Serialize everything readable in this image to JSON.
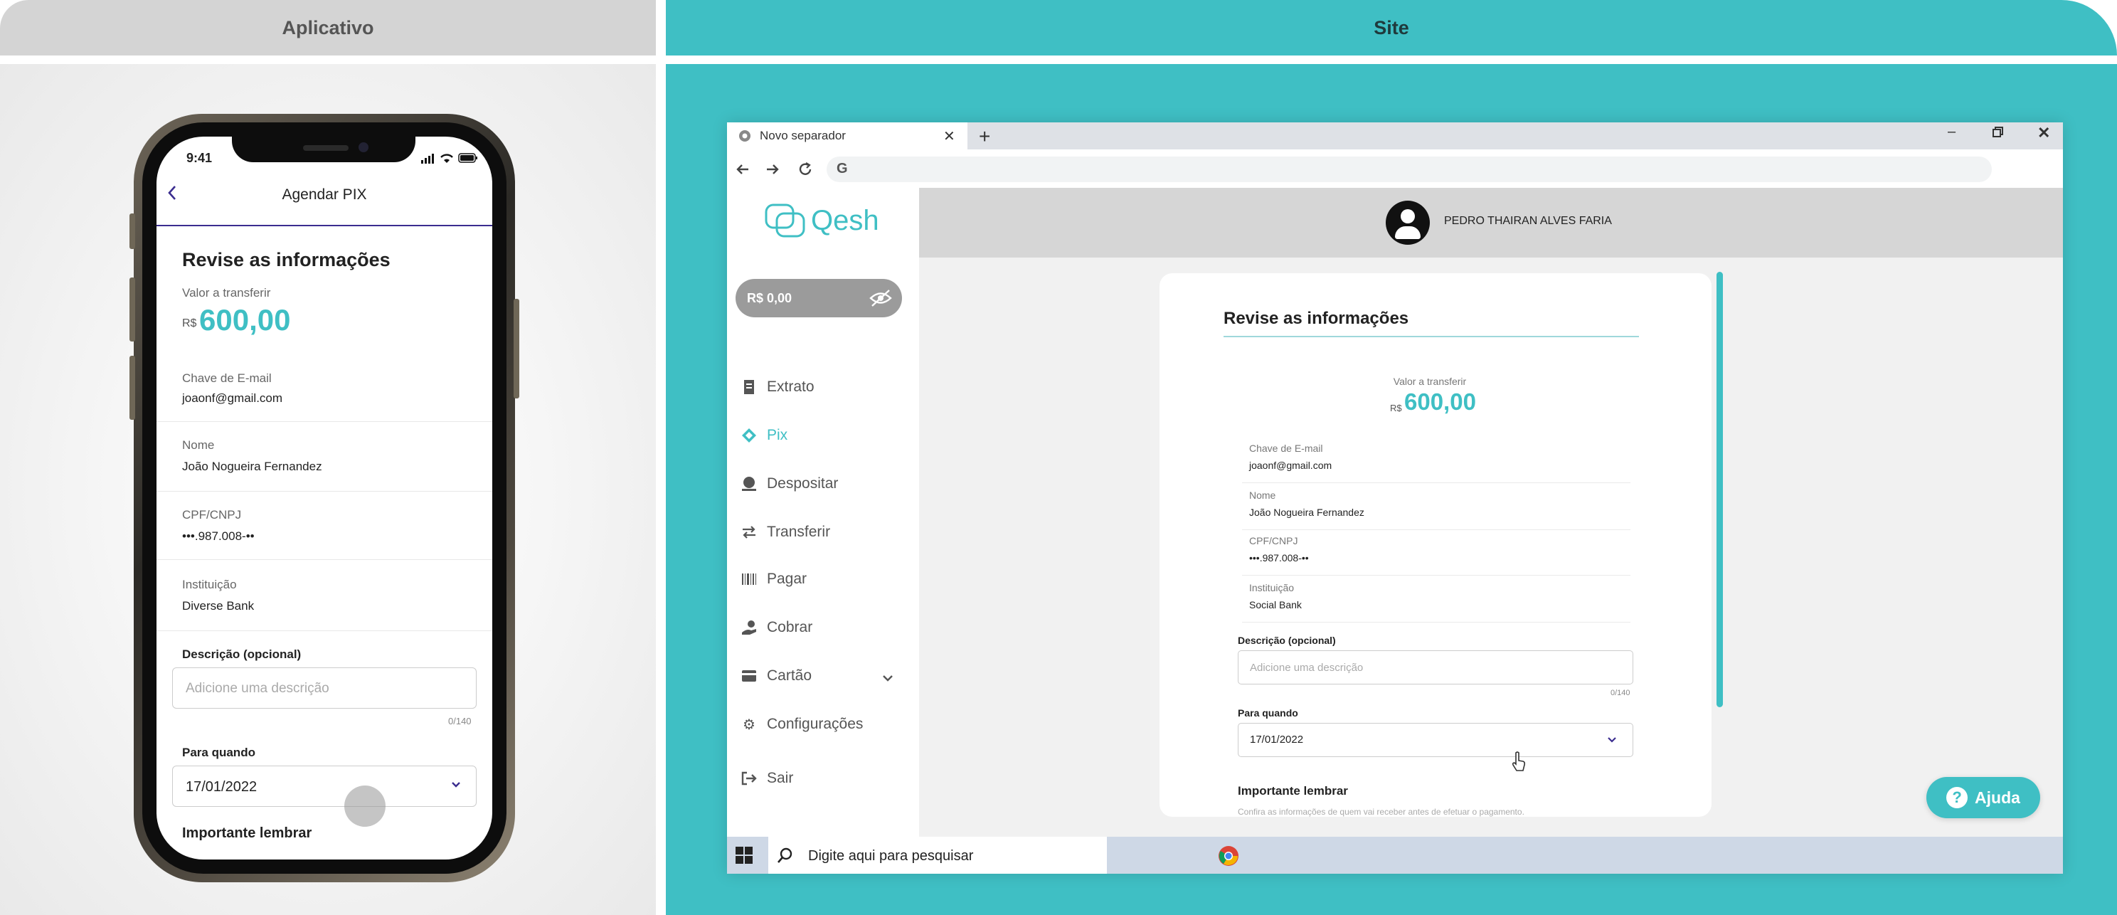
{
  "panels": {
    "left_title": "Aplicativo",
    "right_title": "Site"
  },
  "colors": {
    "accent": "#3fbfc4",
    "purple": "#3b2d8f"
  },
  "phone": {
    "time": "9:41",
    "nav_title": "Agendar PIX",
    "heading": "Revise as informações",
    "amount_label": "Valor a transferir",
    "currency": "R$",
    "amount": "600,00",
    "fields": [
      {
        "label": "Chave de E-mail",
        "value": "joaonf@gmail.com"
      },
      {
        "label": "Nome",
        "value": "João Nogueira Fernandez"
      },
      {
        "label": "CPF/CNPJ",
        "value": "•••.987.008-••"
      },
      {
        "label": "Instituição",
        "value": "Diverse Bank"
      }
    ],
    "description_label": "Descrição (opcional)",
    "description_placeholder": "Adicione uma descrição",
    "char_count": "0/140",
    "when_label": "Para quando",
    "date": "17/01/2022",
    "remember": "Importante lembrar"
  },
  "browser": {
    "tab_title": "Novo separador",
    "search_placeholder": "Digite aqui para pesquisar"
  },
  "site": {
    "logo": "Qesh",
    "user_name": "PEDRO THAIRAN ALVES FARIA",
    "balance": "R$ 0,00",
    "menu": [
      {
        "label": "Extrato",
        "icon": "receipt-icon"
      },
      {
        "label": "Pix",
        "icon": "pix-icon",
        "active": true
      },
      {
        "label": "Despositar",
        "icon": "deposit-icon"
      },
      {
        "label": "Transferir",
        "icon": "transfer-icon"
      },
      {
        "label": "Pagar",
        "icon": "barcode-icon"
      },
      {
        "label": "Cobrar",
        "icon": "charge-icon"
      },
      {
        "label": "Cartão",
        "icon": "card-icon"
      },
      {
        "label": "Configurações",
        "icon": "gear-icon"
      },
      {
        "label": "Sair",
        "icon": "logout-icon"
      }
    ],
    "heading": "Revise as informações",
    "amount_label": "Valor a transferir",
    "currency": "R$",
    "amount": "600,00",
    "fields": [
      {
        "label": "Chave de E-mail",
        "value": "joaonf@gmail.com"
      },
      {
        "label": "Nome",
        "value": "João Nogueira Fernandez"
      },
      {
        "label": "CPF/CNPJ",
        "value": "•••.987.008-••"
      },
      {
        "label": "Instituição",
        "value": "Social Bank"
      }
    ],
    "description_label": "Descrição (opcional)",
    "description_placeholder": "Adicione uma descrição",
    "char_count": "0/140",
    "when_label": "Para quando",
    "date": "17/01/2022",
    "remember": "Importante lembrar",
    "remember_text": "Confira as informações de quem vai receber antes de efetuar o pagamento.",
    "help_label": "Ajuda"
  }
}
